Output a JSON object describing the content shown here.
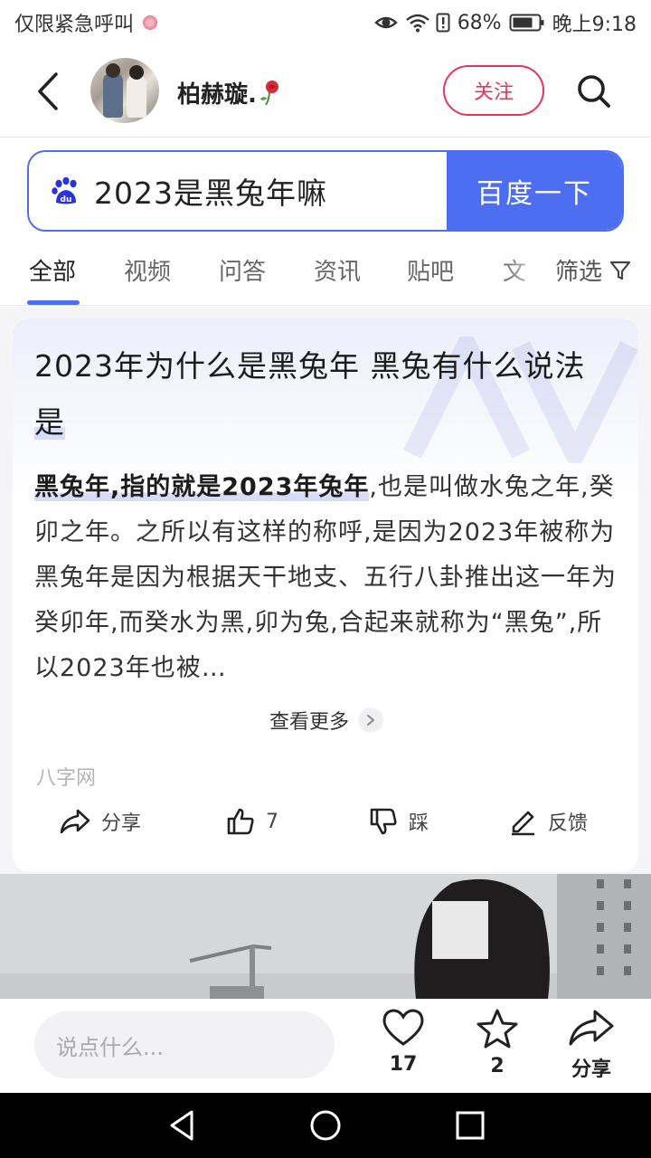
{
  "status_bar": {
    "left_text": "仅限紧急呼叫",
    "battery": "68%",
    "time": "晚上9:18"
  },
  "header": {
    "username": "柏赫璇.",
    "follow_label": "关注"
  },
  "search": {
    "query": "2023是黑兔年嘛",
    "button_label": "百度一下"
  },
  "tabs": {
    "items": [
      "全部",
      "视频",
      "问答",
      "资讯",
      "贴吧",
      "文"
    ],
    "active": "全部",
    "filter_label": "筛选"
  },
  "result": {
    "title_main": "2023年为什么是黑兔年 黑兔有什么说法",
    "title_tail": "是",
    "body_bold": "黑兔年,指的就是2023年兔年",
    "body_rest": ",也是叫做水兔之年,癸卯之年。之所以有这样的称呼,是因为2023年被称为黑兔年是因为根据天干地支、五行八卦推出这一年为癸卯年,而癸水为黑,卯为兔,合起来就称为“黑兔”,所以2023年也被…",
    "see_more_label": "查看更多",
    "source": "八字网",
    "actions": {
      "share_label": "分享",
      "like_count": "7",
      "dislike_label": "踩",
      "feedback_label": "反馈"
    }
  },
  "bottom_bar": {
    "comment_placeholder": "说点什么...",
    "like_count": "17",
    "star_count": "2",
    "share_label": "分享"
  },
  "colors": {
    "accent": "#4e6ef2",
    "follow_red": "#e8335b"
  }
}
